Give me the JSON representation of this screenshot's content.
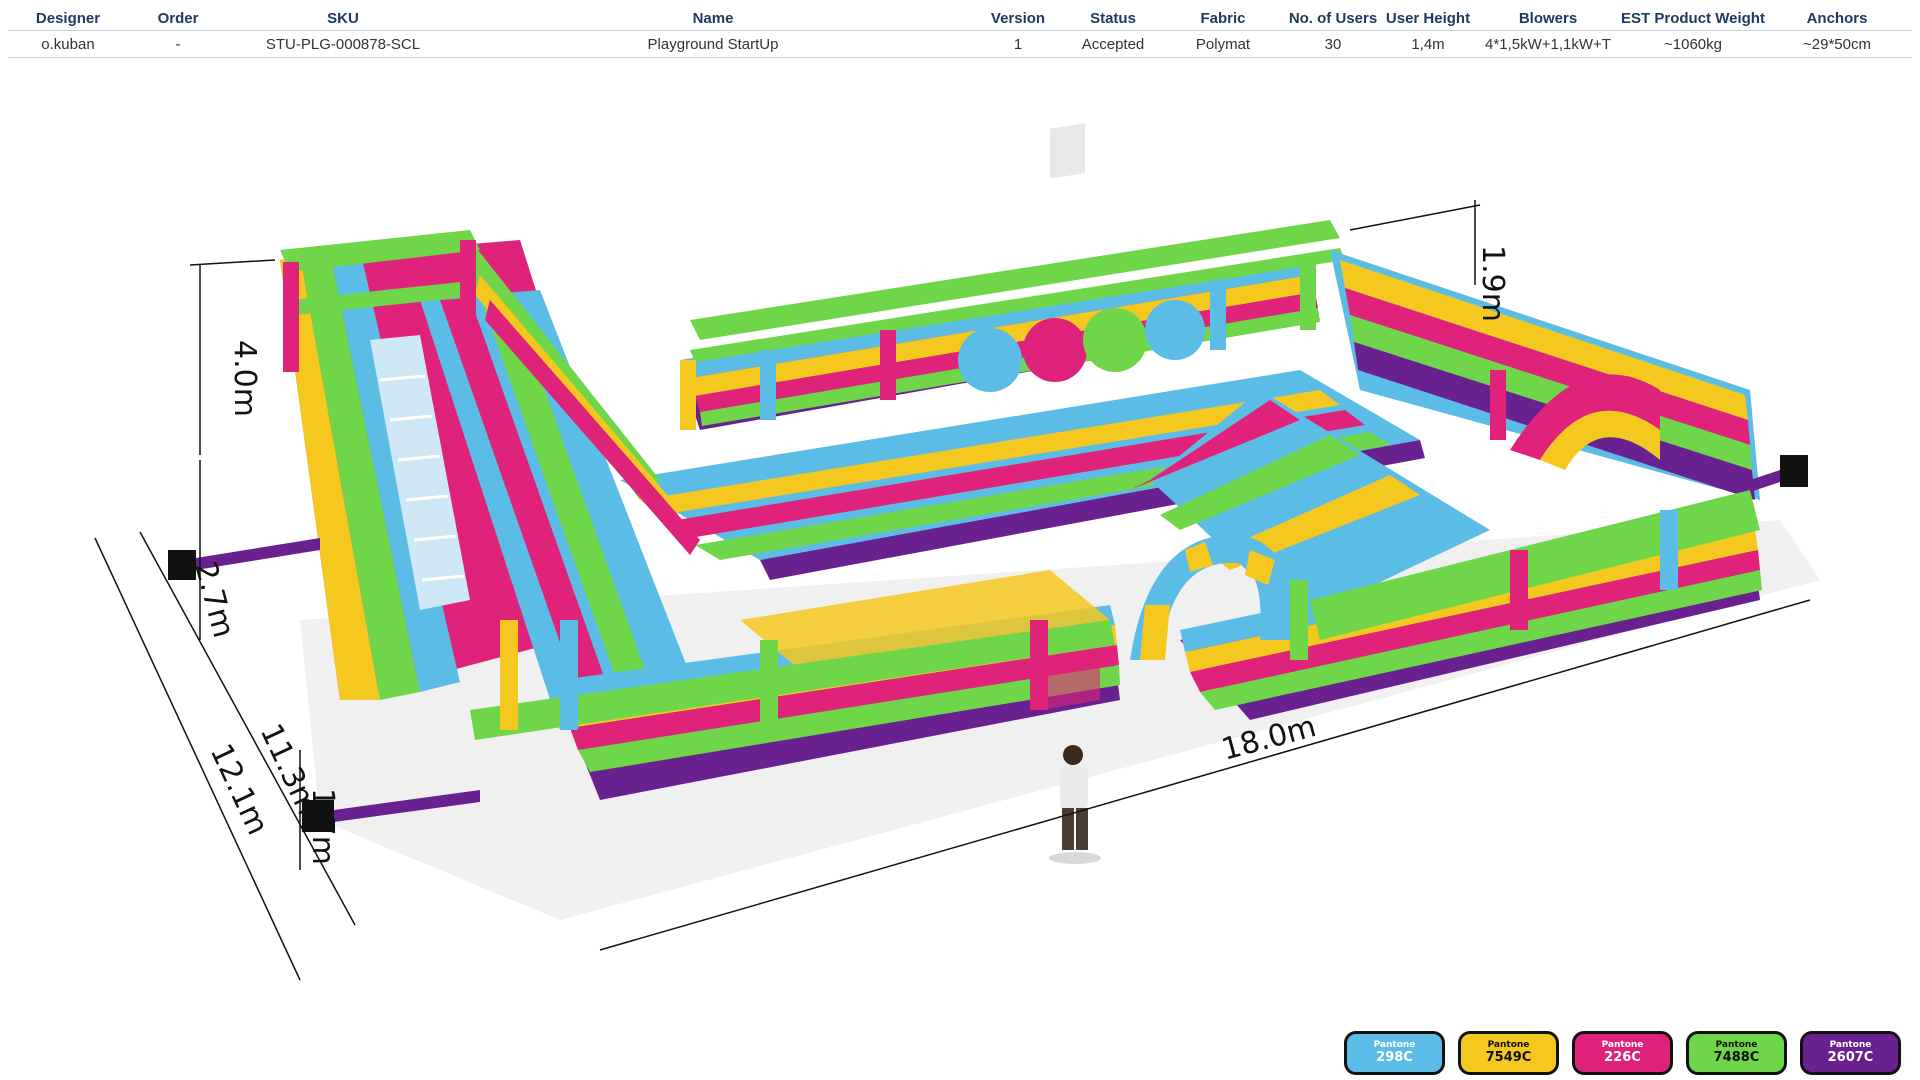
{
  "spec_table": {
    "headers": [
      "Designer",
      "Order",
      "SKU",
      "Name",
      "Version",
      "Status",
      "Fabric",
      "No. of Users",
      "User  Height",
      "Blowers",
      "EST Product Weight",
      "Anchors"
    ],
    "values": [
      "o.kuban",
      "-",
      "STU-PLG-000878-SCL",
      "Playground StartUp",
      "1",
      "Accepted",
      "Polymat",
      "30",
      "1,4m",
      "4*1,5kW+1,1kW+T",
      "~1060kg",
      "~29*50cm"
    ]
  },
  "dimensions": {
    "height_tower": "4.0m",
    "height_base": "2.7m",
    "wall_front": "1.7m",
    "wall_back": "1.9m",
    "width_inner": "11.3m",
    "width_outer": "12.1m",
    "length": "18.0m"
  },
  "pantone": [
    {
      "label": "Pantone",
      "code": "298C",
      "color": "#5bbde6"
    },
    {
      "label": "Pantone",
      "code": "7549C",
      "color": "#f4c81f"
    },
    {
      "label": "Pantone",
      "code": "226C",
      "color": "#e0237a"
    },
    {
      "label": "Pantone",
      "code": "7488C",
      "color": "#6fd64a"
    },
    {
      "label": "Pantone",
      "code": "2607C",
      "color": "#6a2190"
    }
  ]
}
